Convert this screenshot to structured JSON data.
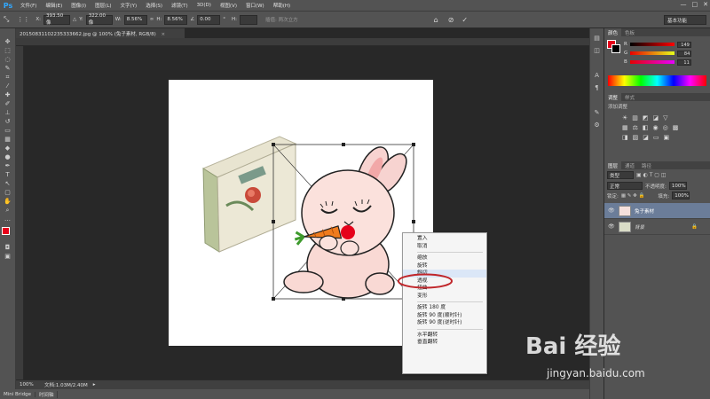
{
  "app": {
    "logo": "Ps"
  },
  "menubar": {
    "items": [
      "文件(F)",
      "编辑(E)",
      "图像(I)",
      "图层(L)",
      "文字(Y)",
      "选择(S)",
      "滤镜(T)",
      "3D(D)",
      "视图(V)",
      "窗口(W)",
      "帮助(H)"
    ],
    "window_controls": [
      "—",
      "□",
      "✕"
    ]
  },
  "options": {
    "x_label": "X:",
    "x_value": "393.50 像",
    "y_label": "Y:",
    "y_value": "322.00 像",
    "w_label": "W:",
    "w_value": "8.56%",
    "h_label": "H:",
    "h_value": "8.56%",
    "angle_value": "0.00",
    "interp_label": "插值: 两次立方",
    "workspace": "基本功能"
  },
  "document": {
    "tab_title": "20150831102235333662.jpg @ 100% (兔子素材, RGB/8)",
    "zoom": "100%",
    "doc_info": "文档:1.03M/2.40M"
  },
  "bottom": {
    "tabs": [
      "Mini Bridge",
      "时间轴"
    ]
  },
  "colors": {
    "canvas_bg": "#ffffff",
    "workspace_bg": "#282828",
    "highlight_ring": "#c0262a",
    "fg_swatch": "#e6001a",
    "bg_swatch": "#000000"
  },
  "color_panel": {
    "tabs": [
      "颜色",
      "色板"
    ],
    "rows": [
      {
        "label": "R",
        "value": "149"
      },
      {
        "label": "G",
        "value": "84"
      },
      {
        "label": "B",
        "value": "11"
      }
    ]
  },
  "adjust_panel": {
    "tabs": [
      "调整",
      "样式"
    ],
    "title": "添加调整"
  },
  "layers_panel": {
    "tabs": [
      "图层",
      "通道",
      "路径"
    ],
    "kind": "类型",
    "blend": "正常",
    "opacity_label": "不透明度:",
    "opacity": "100%",
    "lock_label": "锁定:",
    "fill_label": "填充:",
    "fill": "100%",
    "layers": [
      {
        "name": "兔子素材",
        "active": true
      },
      {
        "name": "背景",
        "active": false
      }
    ]
  },
  "context_menu": {
    "group1": [
      "置入",
      "取消"
    ],
    "group2": [
      "缩放",
      "旋转",
      "斜切",
      "透视",
      "扭曲",
      "变形"
    ],
    "group3": [
      "旋转 180 度",
      "旋转 90 度(顺时针)",
      "旋转 90 度(逆时针)"
    ],
    "group4": [
      "水平翻转",
      "垂直翻转"
    ]
  },
  "watermark": {
    "logo": "Bai 经验",
    "url": "jingyan.baidu.com"
  }
}
